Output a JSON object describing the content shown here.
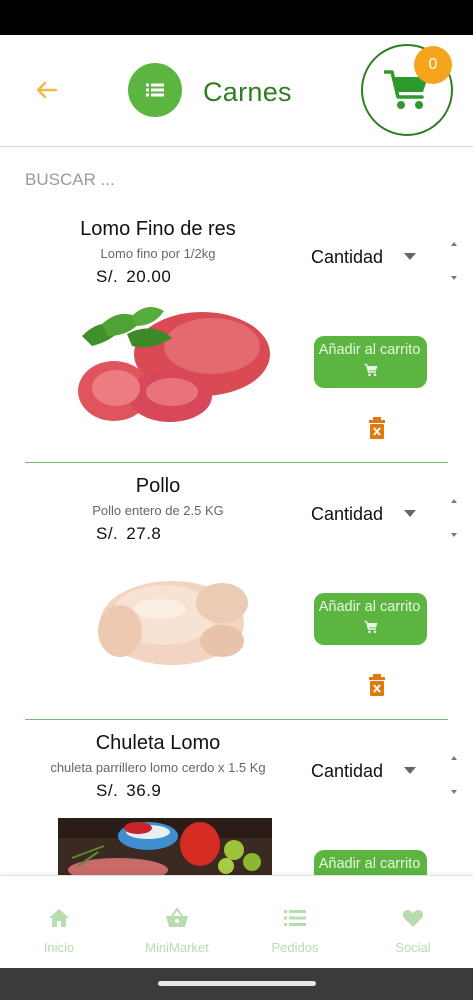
{
  "header": {
    "title": "Carnes",
    "cart_count": "0",
    "icons": {
      "back": "arrow-left-icon",
      "menu": "list-icon",
      "cart": "shopping-cart-icon"
    }
  },
  "search": {
    "placeholder": "BUSCAR ..."
  },
  "products": [
    {
      "name": "Lomo Fino de res",
      "description": "Lomo  fino por  1/2kg",
      "currency": "S/.",
      "price": "20.00",
      "quantity_label": "Cantidad",
      "add_label": "Añadir al carrito",
      "image": "beef-image"
    },
    {
      "name": "Pollo",
      "description": "Pollo entero de 2.5 KG",
      "currency": "S/.",
      "price": "27.8",
      "quantity_label": "Cantidad",
      "add_label": "Añadir al carrito",
      "image": "chicken-image"
    },
    {
      "name": "Chuleta Lomo",
      "description": "chuleta parrillero lomo cerdo x 1.5 Kg",
      "currency": "S/.",
      "price": "36.9",
      "quantity_label": "Cantidad",
      "add_label": "Añadir al carrito",
      "image": "pork-chop-image"
    }
  ],
  "bottom_nav": [
    {
      "label": "Inicio",
      "icon": "home-icon"
    },
    {
      "label": "MiniMarket",
      "icon": "basket-icon"
    },
    {
      "label": "Pedidos",
      "icon": "list-icon"
    },
    {
      "label": "Social",
      "icon": "heart-icon"
    }
  ],
  "colors": {
    "primary": "#5cb541",
    "dark_green": "#2f7f22",
    "accent": "#f4a51c",
    "delete": "#e07a10",
    "nav_inactive": "#b9dcae"
  }
}
